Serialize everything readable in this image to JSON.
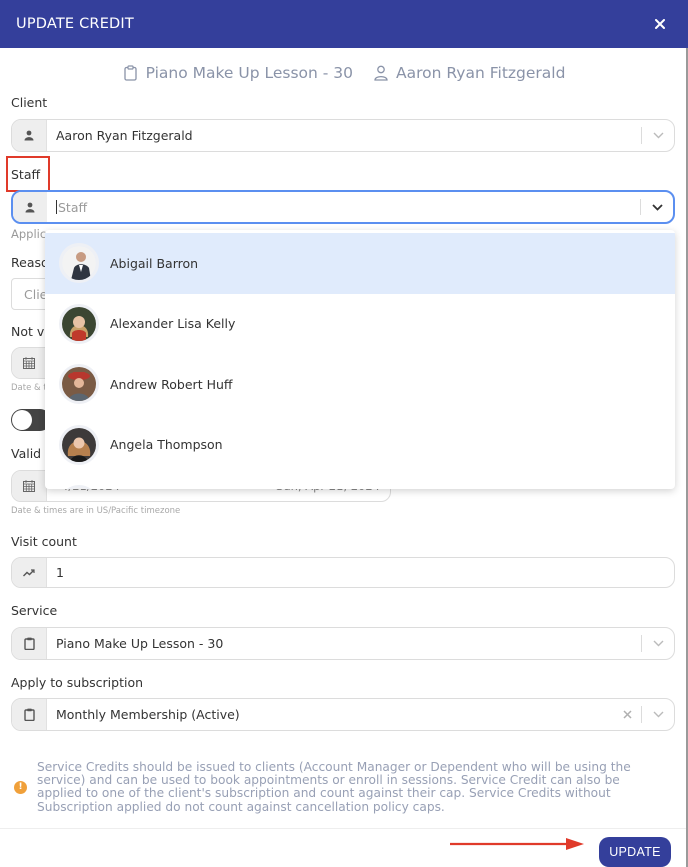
{
  "modal": {
    "title": "UPDATE CREDIT",
    "close_icon": "close-icon",
    "accent_color": "#343f9b"
  },
  "summary": {
    "service_icon": "clipboard-icon",
    "service": "Piano Make Up Lesson - 30",
    "client_icon": "user-icon",
    "client": "Aaron Ryan Fitzgerald"
  },
  "client_field": {
    "label": "Client",
    "icon": "user-icon",
    "value": "Aaron Ryan Fitzgerald"
  },
  "staff_field": {
    "label": "Staff",
    "icon": "user-icon",
    "placeholder": "Staff",
    "value": "",
    "focused": true,
    "options": [
      {
        "name": "Abigail Barron",
        "highlighted": true
      },
      {
        "name": "Alexander Lisa Kelly",
        "highlighted": false
      },
      {
        "name": "Andrew Robert Huff",
        "highlighted": false
      },
      {
        "name": "Angela Thompson",
        "highlighted": false
      }
    ]
  },
  "obscured": {
    "applies_hint_start": "Applic",
    "reason_label_start": "Reaso",
    "reason_value_start": "Clie",
    "not_valid_label_start": "Not va",
    "not_valid_hint_start": "Date & t",
    "valid_until_label_start": "Valid u"
  },
  "valid_until_field": {
    "icon": "calendar-icon",
    "date_fragment": "4/21/2024",
    "date_display_fragment": "Sun, Apr 21, 2024",
    "hint": "Date & times are in US/Pacific timezone"
  },
  "visit_count_field": {
    "label": "Visit count",
    "icon": "trend-icon",
    "value": "1"
  },
  "service_field": {
    "label": "Service",
    "icon": "clipboard-icon",
    "value": "Piano Make Up Lesson - 30"
  },
  "subscription_field": {
    "label": "Apply to subscription",
    "icon": "clipboard-icon",
    "value": "Monthly Membership (Active)",
    "clear_label": "X"
  },
  "info": {
    "icon": "info-icon",
    "text": "Service Credits should be issued to clients (Account Manager or Dependent who will be using the service) and can be used to book appointments or enroll in sessions. Service Credit can also be applied to one of the client's subscription and count against their cap. Service Credits without Subscription applied do not count against cancellation policy caps."
  },
  "footer": {
    "update_label": "UPDATE"
  },
  "annotations": {
    "highlight_box_color": "#e03a2a",
    "arrow_color": "#e03a2a"
  }
}
